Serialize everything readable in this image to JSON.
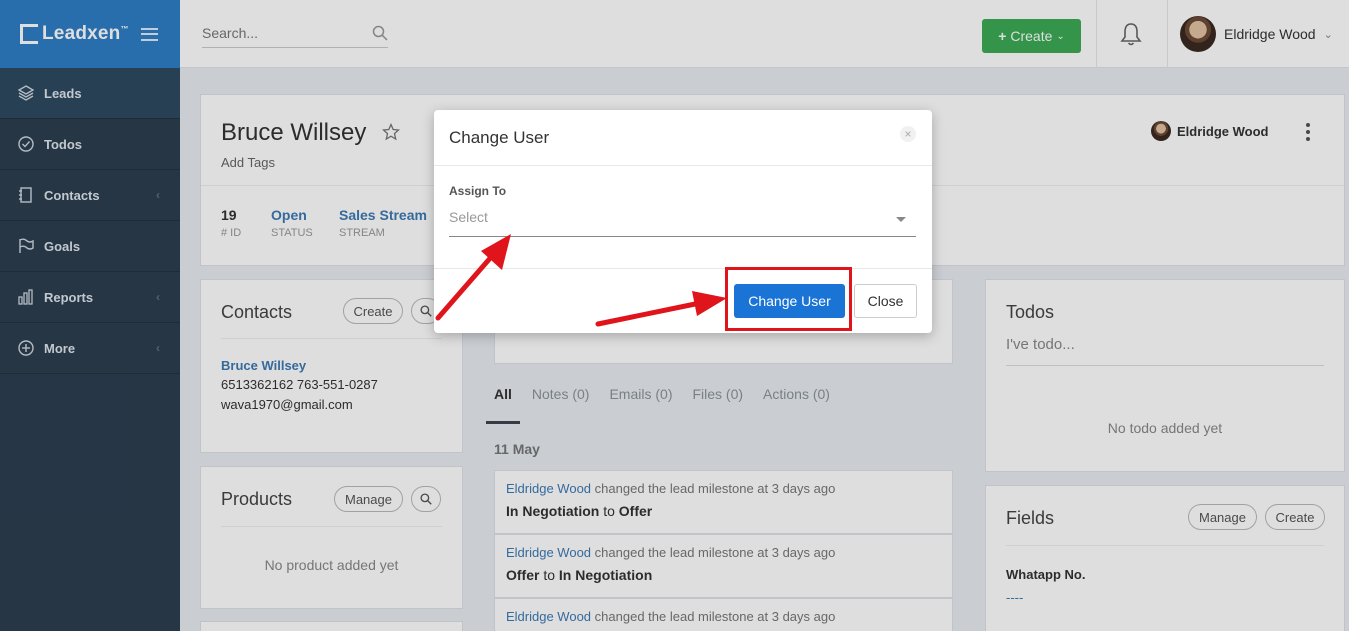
{
  "brand": {
    "name": "Leadxen",
    "tm": "™"
  },
  "sidebar": {
    "items": [
      {
        "label": "Leads",
        "has_chevron": false
      },
      {
        "label": "Todos",
        "has_chevron": false
      },
      {
        "label": "Contacts",
        "has_chevron": true
      },
      {
        "label": "Goals",
        "has_chevron": false
      },
      {
        "label": "Reports",
        "has_chevron": true
      },
      {
        "label": "More",
        "has_chevron": true
      }
    ]
  },
  "topbar": {
    "search_placeholder": "Search...",
    "create_label": "Create",
    "user_name": "Eldridge Wood"
  },
  "lead": {
    "name": "Bruce Willsey",
    "add_tags": "Add Tags",
    "stats": [
      {
        "value": "19",
        "label": "# ID"
      },
      {
        "value": "Open",
        "label": "STATUS"
      },
      {
        "value": "Sales Stream",
        "label": "STREAM"
      }
    ],
    "owner": "Eldridge Wood"
  },
  "contacts_card": {
    "title": "Contacts",
    "create_label": "Create",
    "contact_name": "Bruce Willsey",
    "phones": "6513362162 763-551-0287",
    "email": "wava1970@gmail.com"
  },
  "products_card": {
    "title": "Products",
    "manage_label": "Manage",
    "empty_text": "No product added yet"
  },
  "activity": {
    "tabs": [
      "All",
      "Notes (0)",
      "Emails (0)",
      "Files (0)",
      "Actions (0)"
    ],
    "date": "11 May",
    "items": [
      {
        "actor": "Eldridge Wood",
        "action": "changed the lead milestone at 3 days ago",
        "from": "In Negotiation",
        "connector": "to",
        "to": "Offer"
      },
      {
        "actor": "Eldridge Wood",
        "action": "changed the lead milestone at 3 days ago",
        "from": "Offer",
        "connector": "to",
        "to": "In Negotiation"
      },
      {
        "actor": "Eldridge Wood",
        "action": "changed the lead milestone at 3 days ago"
      }
    ]
  },
  "todos_card": {
    "title": "Todos",
    "input_placeholder": "I've todo...",
    "empty_text": "No todo added yet"
  },
  "fields_card": {
    "title": "Fields",
    "manage_label": "Manage",
    "create_label": "Create",
    "field_label": "Whatapp No.",
    "field_value": "----"
  },
  "modal": {
    "title": "Change User",
    "close_glyph": "×",
    "assign_label": "Assign To",
    "select_placeholder": "Select",
    "primary_label": "Change User",
    "secondary_label": "Close"
  },
  "colors": {
    "sidebar_bg": "#2c3e50",
    "brand_bg": "#2f7fc6",
    "create_green": "#3bab56",
    "link_blue": "#3d7ab5",
    "primary_blue": "#1a74d6",
    "annotation_red": "#e0141b"
  }
}
